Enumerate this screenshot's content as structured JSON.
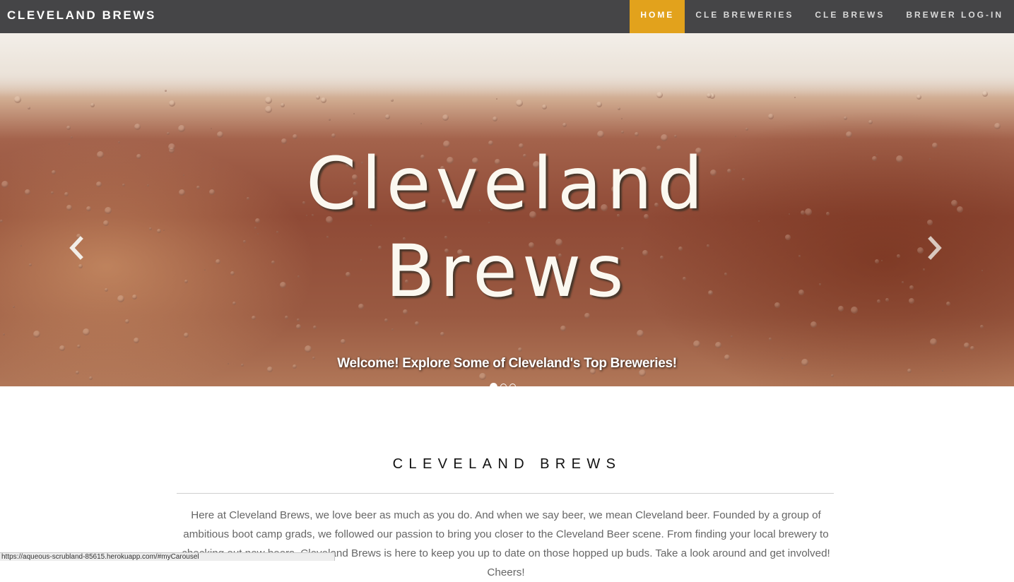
{
  "navbar": {
    "brand": "CLEVELAND BREWS",
    "items": [
      {
        "label": "HOME",
        "active": true
      },
      {
        "label": "CLE BREWERIES",
        "active": false
      },
      {
        "label": "CLE BREWS",
        "active": false
      },
      {
        "label": "BREWER LOG-IN",
        "active": false
      }
    ],
    "colors": {
      "background": "#454547",
      "active": "#e2a21c"
    }
  },
  "carousel": {
    "title_line1": "Cleveland",
    "title_line2": "Brews",
    "caption": "Welcome! Explore Some of Cleveland's Top Breweries!",
    "prev_icon": "chevron-left-icon",
    "next_icon": "chevron-right-icon",
    "slides_count": 3,
    "active_slide": 1
  },
  "about": {
    "heading": "CLEVELAND BREWS",
    "text": "Here at Cleveland Brews, we love beer as much as you do. And when we say beer, we mean Cleveland beer. Founded by a group of ambitious boot camp grads, we followed our passion to bring you closer to the Cleveland Beer scene. From finding your local brewery to checking out new beers, Cleveland Brews is here to keep you up to date on those hopped up buds. Take a look around and get involved! Cheers!"
  },
  "statusbar": {
    "url": "https://aqueous-scrubland-85615.herokuapp.com/#myCarousel"
  }
}
